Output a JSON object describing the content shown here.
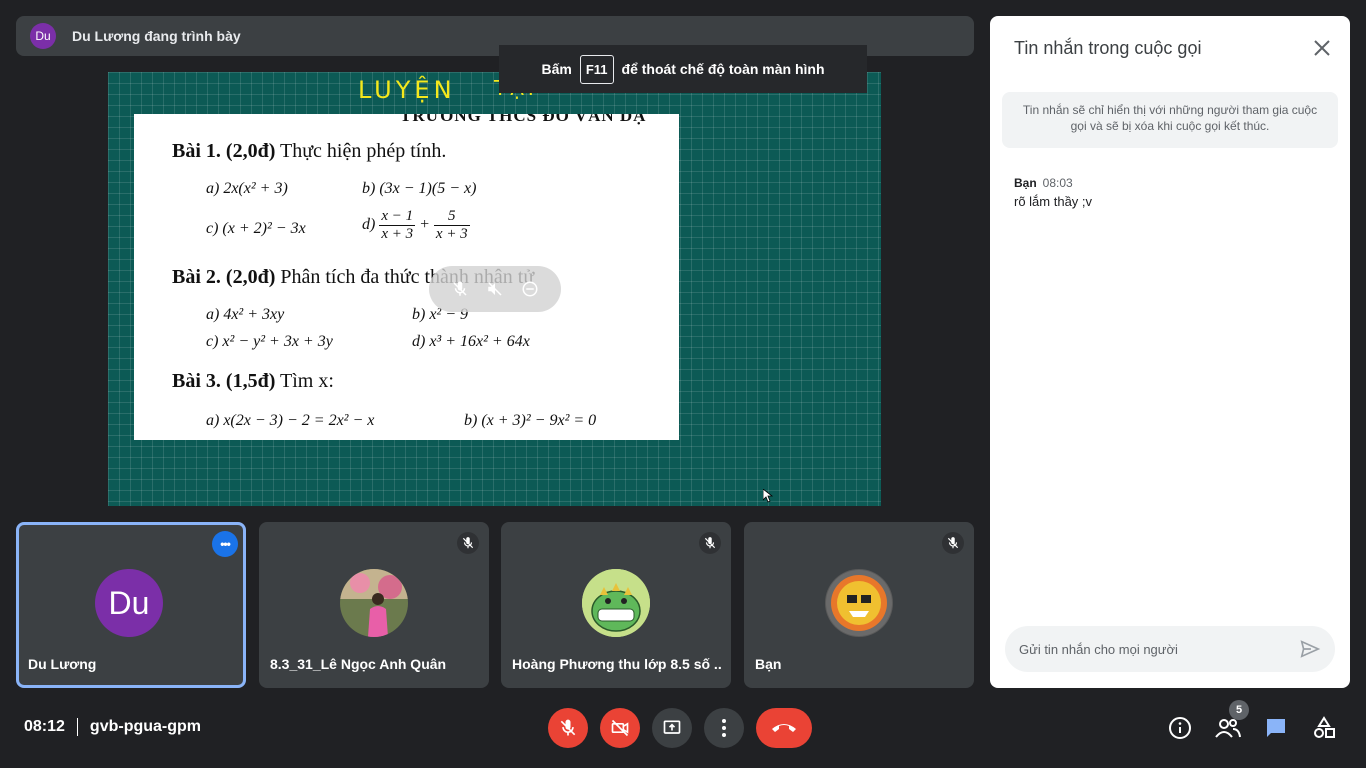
{
  "presenter_bar": {
    "avatar_initials": "Du",
    "title": "Du Lương đang trình bày"
  },
  "fullscreen_hint": {
    "prefix": "Bấm",
    "key": "F11",
    "suffix": "để thoát chế độ toàn màn hình"
  },
  "screen": {
    "handwriting_1": "LUYỆN",
    "handwriting_2": "TẬP",
    "doc_header": "TRƯỜNG THCS ĐỖ VĂN DẬ",
    "bai1_title": "Bài 1.",
    "bai1_points": "(2,0đ)",
    "bai1_text": "Thực hiện phép tính.",
    "bai1_a": "a) 2x(x² + 3)",
    "bai1_b": "b) (3x − 1)(5 − x)",
    "bai1_c": "c) (x + 2)² − 3x",
    "bai1_d_label": "d)",
    "bai1_d_num1": "x − 1",
    "bai1_d_den1": "x + 3",
    "bai1_d_num2": "5",
    "bai1_d_den2": "x + 3",
    "bai2_title": "Bài 2.",
    "bai2_points": "(2,0đ)",
    "bai2_text": "Phân tích đa thức thành nhân tử",
    "bai2_a": "a) 4x² + 3xy",
    "bai2_b": "b) x² − 9",
    "bai2_c": "c) x² − y² + 3x + 3y",
    "bai2_d": "d) x³ + 16x² + 64x",
    "bai3_title": "Bài 3.",
    "bai3_points": "(1,5đ)",
    "bai3_text": "Tìm x:",
    "bai3_a": "a) x(2x − 3) − 2 = 2x² − x",
    "bai3_b": "b) (x + 3)² − 9x² = 0"
  },
  "tiles": [
    {
      "name": "Du Lương",
      "avatar_initials": "Du",
      "active": true
    },
    {
      "name": "8.3_31_Lê Ngọc Anh Quân",
      "muted": true
    },
    {
      "name": "Hoàng Phương thu lớp 8.5 số ...",
      "muted": true
    },
    {
      "name": "Bạn",
      "muted": true
    }
  ],
  "chat": {
    "title": "Tin nhắn trong cuộc gọi",
    "note": "Tin nhắn sẽ chỉ hiển thị với những người tham gia cuộc gọi và sẽ bị xóa khi cuộc gọi kết thúc.",
    "messages": [
      {
        "sender": "Bạn",
        "time": "08:03",
        "text": "rõ lắm thầy ;v"
      }
    ],
    "input_placeholder": "Gửi tin nhắn cho mọi người"
  },
  "bottom_bar": {
    "time": "08:12",
    "meeting_code": "gvb-pgua-gpm",
    "participants_count": "5"
  },
  "colors": {
    "accent": "#8ab4f8",
    "danger": "#ea4335",
    "chat_blue": "#8ab4f8",
    "presenter_avatar": "#7b2fa8"
  }
}
